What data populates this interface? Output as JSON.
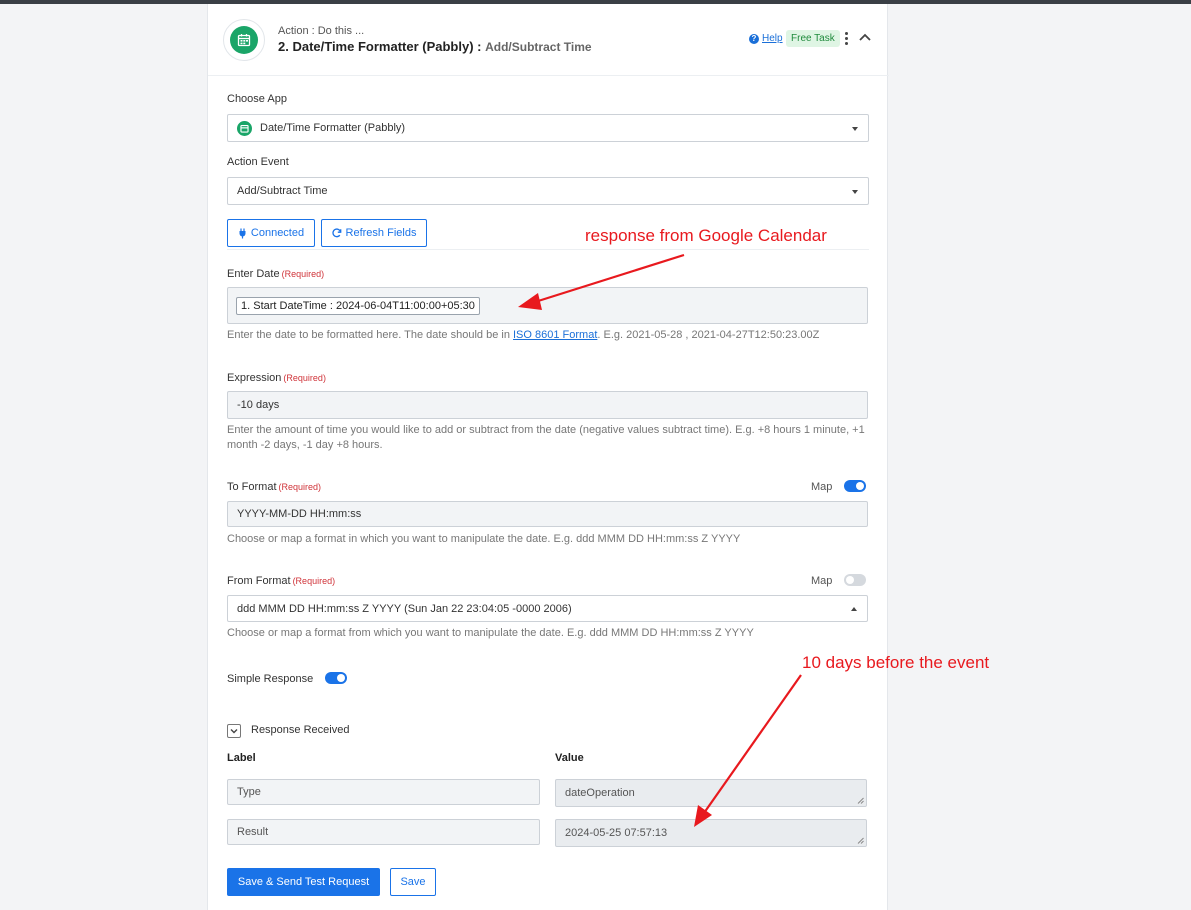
{
  "header": {
    "action_label": "Action : Do this ...",
    "title": "2. Date/Time Formatter (Pabbly) :",
    "event": "Add/Subtract Time",
    "help": "Help",
    "badge": "Free Task"
  },
  "choose_app": {
    "label": "Choose App",
    "value": "Date/Time Formatter (Pabbly)"
  },
  "action_event": {
    "label": "Action Event",
    "value": "Add/Subtract Time"
  },
  "buttons": {
    "connected": "Connected",
    "refresh": "Refresh Fields",
    "save_test": "Save & Send Test Request",
    "save": "Save"
  },
  "required": "(Required)",
  "enter_date": {
    "label": "Enter Date",
    "value": "1. Start DateTime : 2024-06-04T11:00:00+05:30",
    "hint_pre": "Enter the date to be formatted here. The date should be in",
    "hint_link": "ISO 8601 Format",
    "hint_post": ". E.g. 2021-05-28 , 2021-04-27T12:50:23.00Z"
  },
  "expression": {
    "label": "Expression",
    "value": "-10 days",
    "hint": "Enter the amount of time you would like to add or subtract from the date (negative values subtract time). E.g. +8 hours 1 minute, +1 month -2 days, -1 day +8 hours."
  },
  "to_format": {
    "label": "To Format",
    "map": "Map",
    "map_on": true,
    "value": "YYYY-MM-DD HH:mm:ss",
    "hint": "Choose or map a format in which you want to manipulate the date. E.g. ddd MMM DD HH:mm:ss Z YYYY"
  },
  "from_format": {
    "label": "From Format",
    "map": "Map",
    "map_on": false,
    "value": "ddd MMM DD HH:mm:ss Z YYYY (Sun Jan 22 23:04:05 -0000 2006)",
    "hint": "Choose or map a format from which you want to manipulate the date. E.g. ddd MMM DD HH:mm:ss Z YYYY"
  },
  "simple_response": {
    "label": "Simple Response",
    "on": true
  },
  "response": {
    "title": "Response Received",
    "label_head": "Label",
    "value_head": "Value",
    "rows": [
      {
        "label": "Type",
        "value": "dateOperation"
      },
      {
        "label": "Result",
        "value": "2024-05-25 07:57:13"
      }
    ]
  },
  "annotations": {
    "top": "response from Google Calendar",
    "bottom": "10 days before the event"
  },
  "colors": {
    "primary": "#1a73e8",
    "annotation": "#e8191e",
    "logo": "#1aa568"
  },
  "icons": [
    "calendar-icon",
    "plug-icon",
    "refresh-icon",
    "help-icon",
    "kebab-icon",
    "chevron-up-icon",
    "chevron-down-icon"
  ]
}
